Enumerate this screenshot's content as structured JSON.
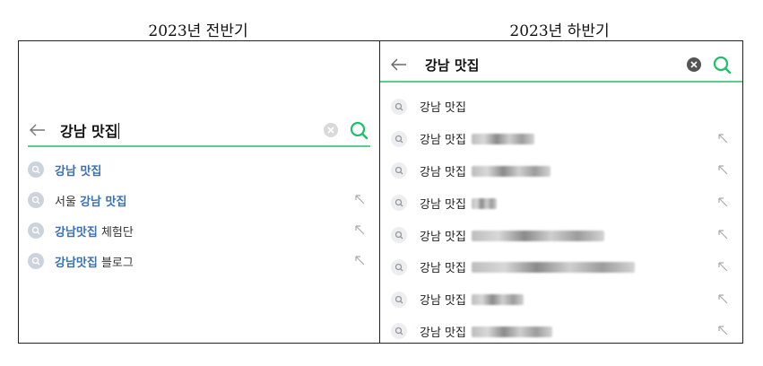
{
  "captions": {
    "left": "2023년 전반기",
    "right": "2023년 하반기"
  },
  "left_panel": {
    "query": "강남 맛집",
    "suggestions": [
      {
        "highlight": "강남 맛집",
        "prefix": "",
        "suffix": "",
        "has_arrow": false
      },
      {
        "prefix": "서울 ",
        "highlight": "강남 맛집",
        "suffix": "",
        "has_arrow": true
      },
      {
        "prefix": "",
        "highlight": "강남맛집",
        "suffix": " 체험단",
        "has_arrow": true
      },
      {
        "prefix": "",
        "highlight": "강남맛집",
        "suffix": " 블로그",
        "has_arrow": true
      }
    ]
  },
  "right_panel": {
    "query": "강남 맛집",
    "suggestions": [
      {
        "text": "강남 맛집",
        "blurred": false,
        "has_arrow": false
      },
      {
        "text": "강남 맛집",
        "blurred": true,
        "has_arrow": true
      },
      {
        "text": "강남 맛집",
        "blurred": true,
        "has_arrow": true
      },
      {
        "text": "강남 맛집",
        "blurred": true,
        "has_arrow": true
      },
      {
        "text": "강남 맛집",
        "blurred": true,
        "has_arrow": true
      },
      {
        "text": "강남 맛집",
        "blurred": true,
        "has_arrow": true
      },
      {
        "text": "강남 맛집",
        "blurred": true,
        "has_arrow": true
      },
      {
        "text": "강남 맛집",
        "blurred": true,
        "has_arrow": true
      }
    ]
  },
  "colors": {
    "accent_green": "#5ccf8a",
    "highlight_blue": "#3b6fb6"
  },
  "icons": {
    "back": "arrow-left-icon",
    "clear": "clear-icon",
    "search": "search-icon",
    "suggestion": "magnifier-icon",
    "fill_query": "arrow-up-left-icon"
  }
}
